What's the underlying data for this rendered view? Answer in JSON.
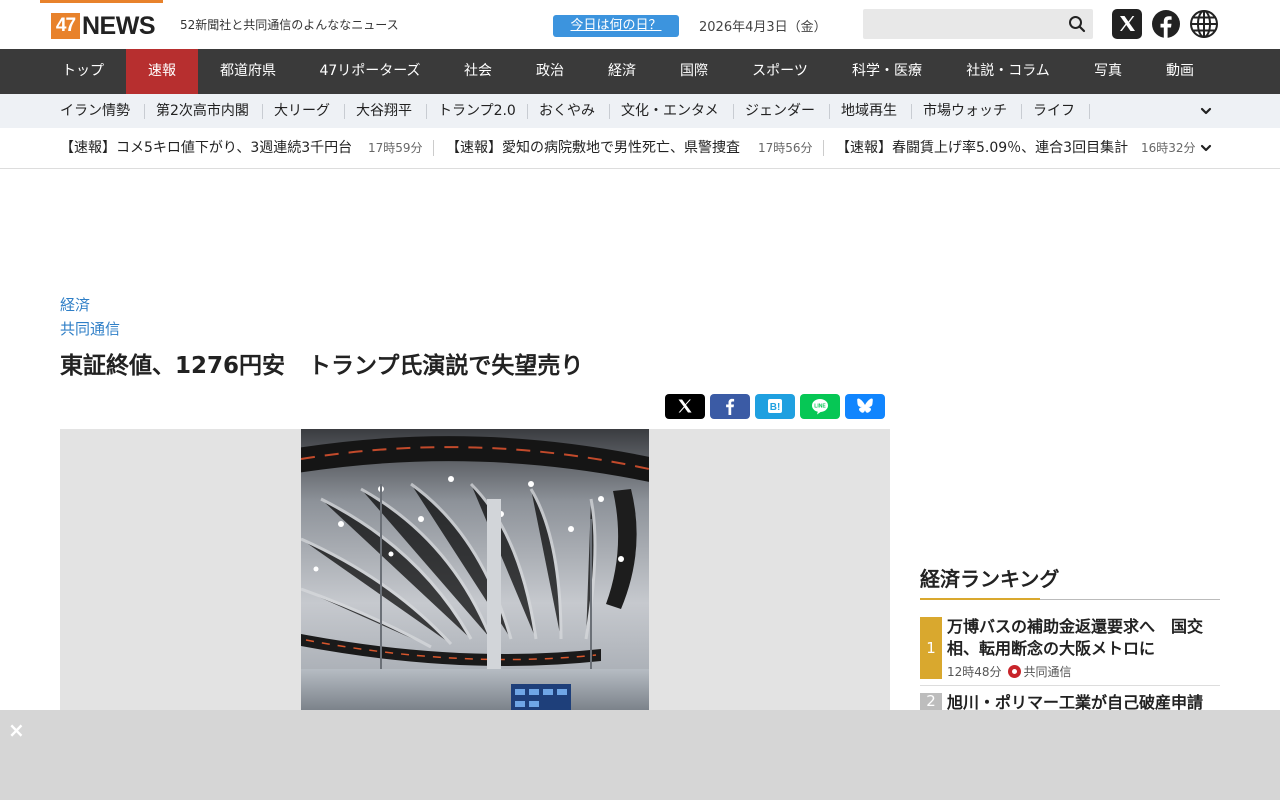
{
  "header": {
    "logo_number": "47",
    "logo_word": "NEWS",
    "tagline": "52新聞社と共同通信のよんななニュース",
    "today_button": "今日は何の日？",
    "date": "2026年4月3日（金）",
    "search_placeholder": ""
  },
  "colors": {
    "brand_orange": "#e8822b",
    "nav_bg": "#3a3a3a",
    "nav_active": "#b72f2f",
    "link_blue": "#2f7fc7",
    "rank_gold": "#d9a82e"
  },
  "main_nav": [
    {
      "label": "トップ"
    },
    {
      "label": "速報",
      "active": true
    },
    {
      "label": "都道府県"
    },
    {
      "label": "47リポーターズ"
    },
    {
      "label": "社会"
    },
    {
      "label": "政治"
    },
    {
      "label": "経済"
    },
    {
      "label": "国際"
    },
    {
      "label": "スポーツ"
    },
    {
      "label": "科学・医療"
    },
    {
      "label": "社説・コラム"
    },
    {
      "label": "写真"
    },
    {
      "label": "動画"
    }
  ],
  "sub_nav": [
    {
      "label": "イラン情勢"
    },
    {
      "label": "第2次高市内閣"
    },
    {
      "label": "大リーグ"
    },
    {
      "label": "大谷翔平"
    },
    {
      "label": "トランプ2.0"
    },
    {
      "label": "おくやみ"
    },
    {
      "label": "文化・エンタメ"
    },
    {
      "label": "ジェンダー"
    },
    {
      "label": "地域再生"
    },
    {
      "label": "市場ウォッチ"
    },
    {
      "label": "ライフ"
    }
  ],
  "flash_news": [
    {
      "text": "【速報】コメ5キロ値下がり、3週連続3千円台",
      "time": "17時59分"
    },
    {
      "text": "【速報】愛知の病院敷地で男性死亡、県警捜査",
      "time": "17時56分"
    },
    {
      "text": "【速報】春闘賃上げ率5.09％、連合3回目集計",
      "time": "16時32分"
    }
  ],
  "article": {
    "category": "経済",
    "source": "共同通信",
    "title": "東証終値、1276円安　トランプ氏演説で失望売り",
    "photo_icon": "stock-exchange-photo"
  },
  "share_buttons": [
    {
      "icon": "x-icon",
      "color": "#000000"
    },
    {
      "icon": "facebook-icon",
      "color": "#3b5ba5"
    },
    {
      "icon": "hatena-bookmark-icon",
      "color": "#1fa0e0"
    },
    {
      "icon": "line-icon",
      "color": "#06c755"
    },
    {
      "icon": "bluesky-icon",
      "color": "#1185fe"
    }
  ],
  "ranking": {
    "title": "経済ランキング",
    "items": [
      {
        "rank": "1",
        "text": "万博バスの補助金返還要求へ　国交相、転用断念の大阪メトロに",
        "time": "12時48分",
        "source": "共同通信"
      },
      {
        "rank": "2",
        "text": "旭川・ポリマー工業が自己破産申請"
      }
    ]
  }
}
